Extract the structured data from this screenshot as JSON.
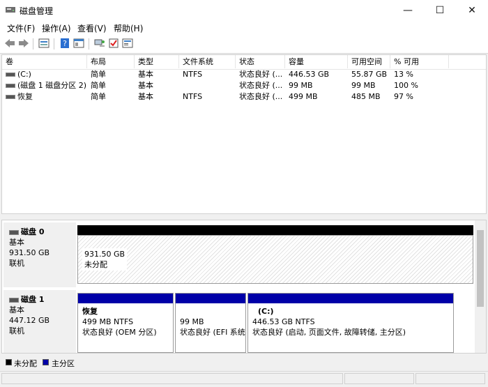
{
  "window": {
    "title": "磁盘管理",
    "minimize": "—",
    "maximize": "☐",
    "close": "✕"
  },
  "menu": [
    {
      "label": "文件(F)"
    },
    {
      "label": "操作(A)"
    },
    {
      "label": "查看(V)"
    },
    {
      "label": "帮助(H)"
    }
  ],
  "toolbar": {
    "icons": [
      "back-icon",
      "forward-icon",
      "disk-list-icon",
      "help-icon",
      "properties-icon",
      "connect-icon",
      "check-icon",
      "settings-icon"
    ]
  },
  "volumes": {
    "columns": [
      "卷",
      "布局",
      "类型",
      "文件系统",
      "状态",
      "容量",
      "可用空间",
      "% 可用"
    ],
    "rows": [
      {
        "vol": "(C:)",
        "layout": "简单",
        "type": "基本",
        "fs": "NTFS",
        "status": "状态良好 (...",
        "capacity": "446.53 GB",
        "free": "55.87 GB",
        "pct": "13 %"
      },
      {
        "vol": "(磁盘 1 磁盘分区 2)",
        "layout": "简单",
        "type": "基本",
        "fs": "",
        "status": "状态良好 (...",
        "capacity": "99 MB",
        "free": "99 MB",
        "pct": "100 %"
      },
      {
        "vol": "恢复",
        "layout": "简单",
        "type": "基本",
        "fs": "NTFS",
        "status": "状态良好 (...",
        "capacity": "499 MB",
        "free": "485 MB",
        "pct": "97 %"
      }
    ]
  },
  "disks": [
    {
      "name": "磁盘 0",
      "type": "基本",
      "size": "931.50 GB",
      "state": "联机",
      "partitions": [
        {
          "name": "",
          "size": "931.50 GB",
          "status": "未分配"
        }
      ]
    },
    {
      "name": "磁盘 1",
      "type": "基本",
      "size": "447.12 GB",
      "state": "联机",
      "partitions": [
        {
          "name": "恢复",
          "size": "499 MB NTFS",
          "status": "状态良好 (OEM 分区)"
        },
        {
          "name": "",
          "size": "99 MB",
          "status": "状态良好 (EFI 系统"
        },
        {
          "name": "(C:)",
          "size": "446.53 GB NTFS",
          "status": "状态良好 (启动, 页面文件, 故障转储, 主分区)"
        }
      ]
    }
  ],
  "legend": {
    "unallocated": "未分配",
    "primary": "主分区"
  },
  "colors": {
    "unallocated": "#000000",
    "primary": "#0000a8",
    "title_bg": "#ffffff"
  }
}
